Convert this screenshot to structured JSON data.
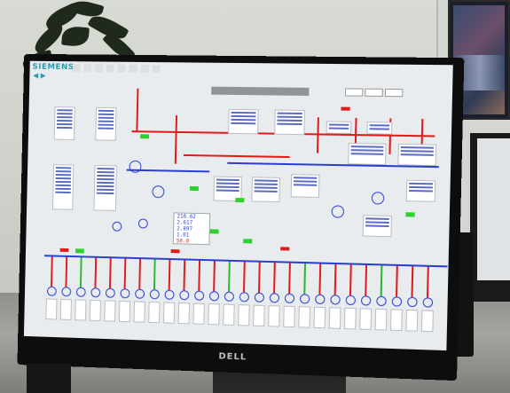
{
  "screen": {
    "brand": "SIEMENS",
    "panel_values": [
      "216.62",
      "2.617",
      "2.897",
      "1.01",
      "50.0"
    ],
    "panel_red_index": 4
  },
  "monitor": {
    "brand": "DELL"
  },
  "colors": {
    "bus_high": "#e11b1b",
    "bus_low": "#2a3fd0",
    "closed_state": "#2ed12e",
    "open_state": "#e11b1b",
    "brand": "#2c9aa8"
  }
}
